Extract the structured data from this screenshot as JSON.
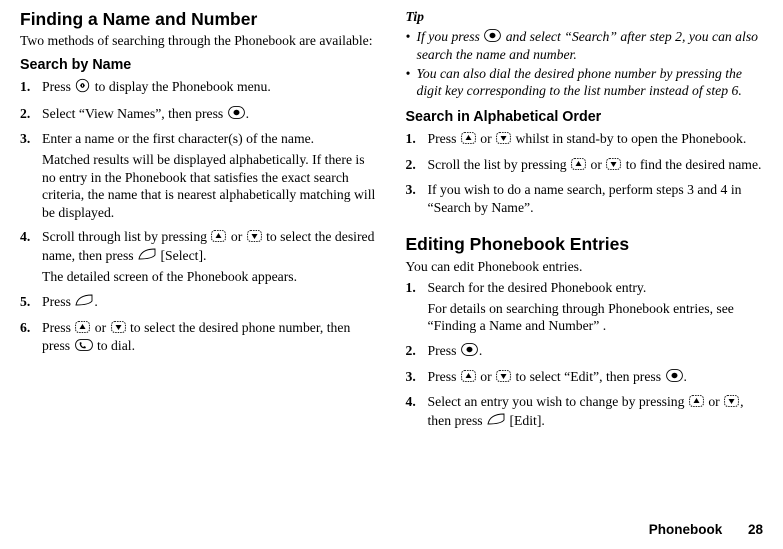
{
  "left": {
    "h2": "Finding a Name and Number",
    "intro": "Two methods of searching through the Phonebook are available:",
    "h3": "Search by Name",
    "steps": [
      {
        "n": "1.",
        "lines": [
          "Press ",
          " to display the Phonebook menu."
        ]
      },
      {
        "n": "2.",
        "lines": [
          "Select “View Names”, then press ",
          "."
        ]
      },
      {
        "n": "3.",
        "p1": "Enter a name or the first character(s) of the name.",
        "p2": "Matched results will be displayed alphabetically. If there is no entry in the Phonebook that satisfies the exact search criteria, the name that is nearest alphabetically matching will be displayed."
      },
      {
        "n": "4.",
        "p1a": "Scroll through list by pressing ",
        "p1b": " or ",
        "p1c": " to select the desired name, then press ",
        "p1d": " [Select].",
        "p2": "The detailed screen of the Phonebook appears."
      },
      {
        "n": "5.",
        "lines": [
          "Press ",
          "."
        ]
      },
      {
        "n": "6.",
        "a": "Press ",
        "b": " or ",
        "c": " to select the desired phone number, then press ",
        "d": " to dial."
      }
    ]
  },
  "right": {
    "tipLabel": "Tip",
    "tips": [
      {
        "a": "If you press ",
        "b": " and select “Search” after step 2, you can also search the name and number."
      },
      {
        "t": "You can also dial the desired phone number by pressing the digit key corresponding to the list number instead of step 6."
      }
    ],
    "h3a": "Search in Alphabetical Order",
    "alphaSteps": [
      {
        "n": "1.",
        "a": "Press ",
        "b": " or ",
        "c": " whilst in stand-by to open the Phonebook."
      },
      {
        "n": "2.",
        "a": "Scroll the list by pressing ",
        "b": " or ",
        "c": " to find the desired name."
      },
      {
        "n": "3.",
        "t": "If you wish to do a name search, perform steps 3 and 4 in “Search by Name”."
      }
    ],
    "h2b": "Editing Phonebook Entries",
    "editIntro": "You can edit Phonebook entries.",
    "editSteps": [
      {
        "n": "1.",
        "p1": "Search for the desired Phonebook entry.",
        "p2": "For details on searching through Phonebook entries, see “Finding a Name and Number” ."
      },
      {
        "n": "2.",
        "a": "Press ",
        "b": "."
      },
      {
        "n": "3.",
        "a": "Press ",
        "b": " or ",
        "c": " to select “Edit”, then press ",
        "d": "."
      },
      {
        "n": "4.",
        "a": "Select an entry you wish to change by pressing ",
        "b": " or ",
        "c": ", then press ",
        "d": " [Edit]."
      }
    ]
  },
  "footer": {
    "section": "Phonebook",
    "page": "28"
  }
}
